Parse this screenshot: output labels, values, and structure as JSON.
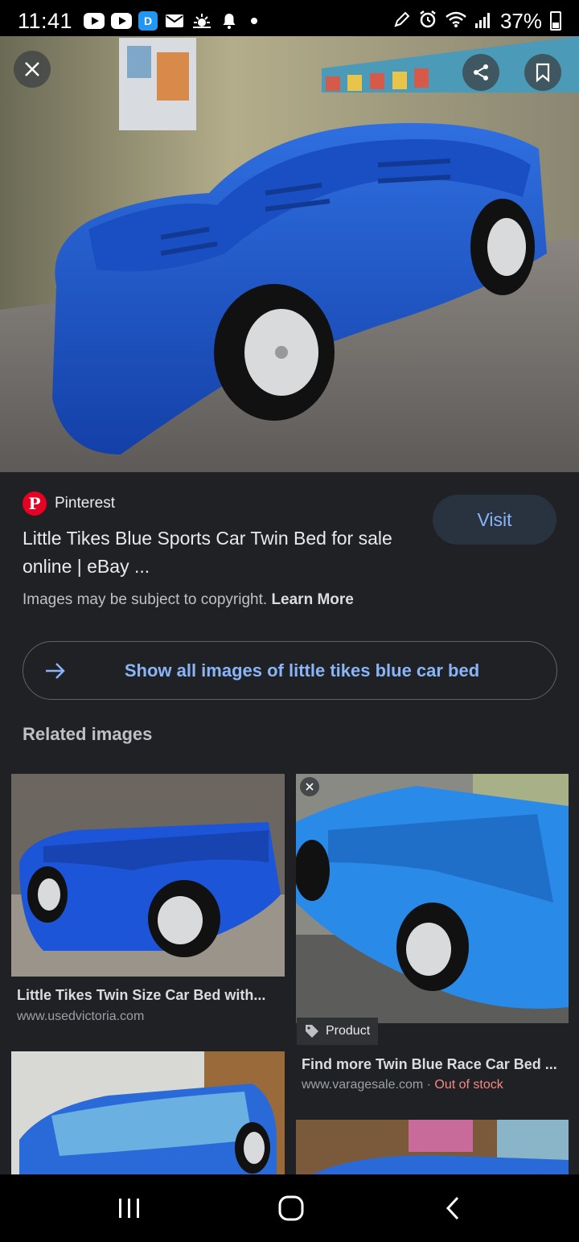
{
  "status_bar": {
    "time": "11:41",
    "battery": "37%"
  },
  "hero": {
    "share_icon": "share-icon",
    "bookmark_icon": "bookmark-icon",
    "close_icon": "close-icon"
  },
  "result": {
    "source": "Pinterest",
    "title": "Little Tikes Blue Sports Car Twin Bed for sale online | eBay ...",
    "visit_label": "Visit",
    "copyright_text": "Images may be subject to copyright.",
    "learn_more": "Learn More"
  },
  "show_all": {
    "label": "Show all images of little tikes blue car bed"
  },
  "related": {
    "heading": "Related images",
    "items": [
      {
        "title": "Little Tikes Twin Size Car Bed with...",
        "site": "www.usedvictoria.com"
      },
      {
        "title": "Find more Twin Blue Race Car Bed ...",
        "site": "www.varagesale.com",
        "separator": " · ",
        "stock": "Out of stock",
        "badge": "Product"
      }
    ]
  },
  "colors": {
    "accent": "#8ab4f8",
    "background": "#202124",
    "pinterest": "#e60023",
    "out_of_stock": "#f28b82"
  }
}
